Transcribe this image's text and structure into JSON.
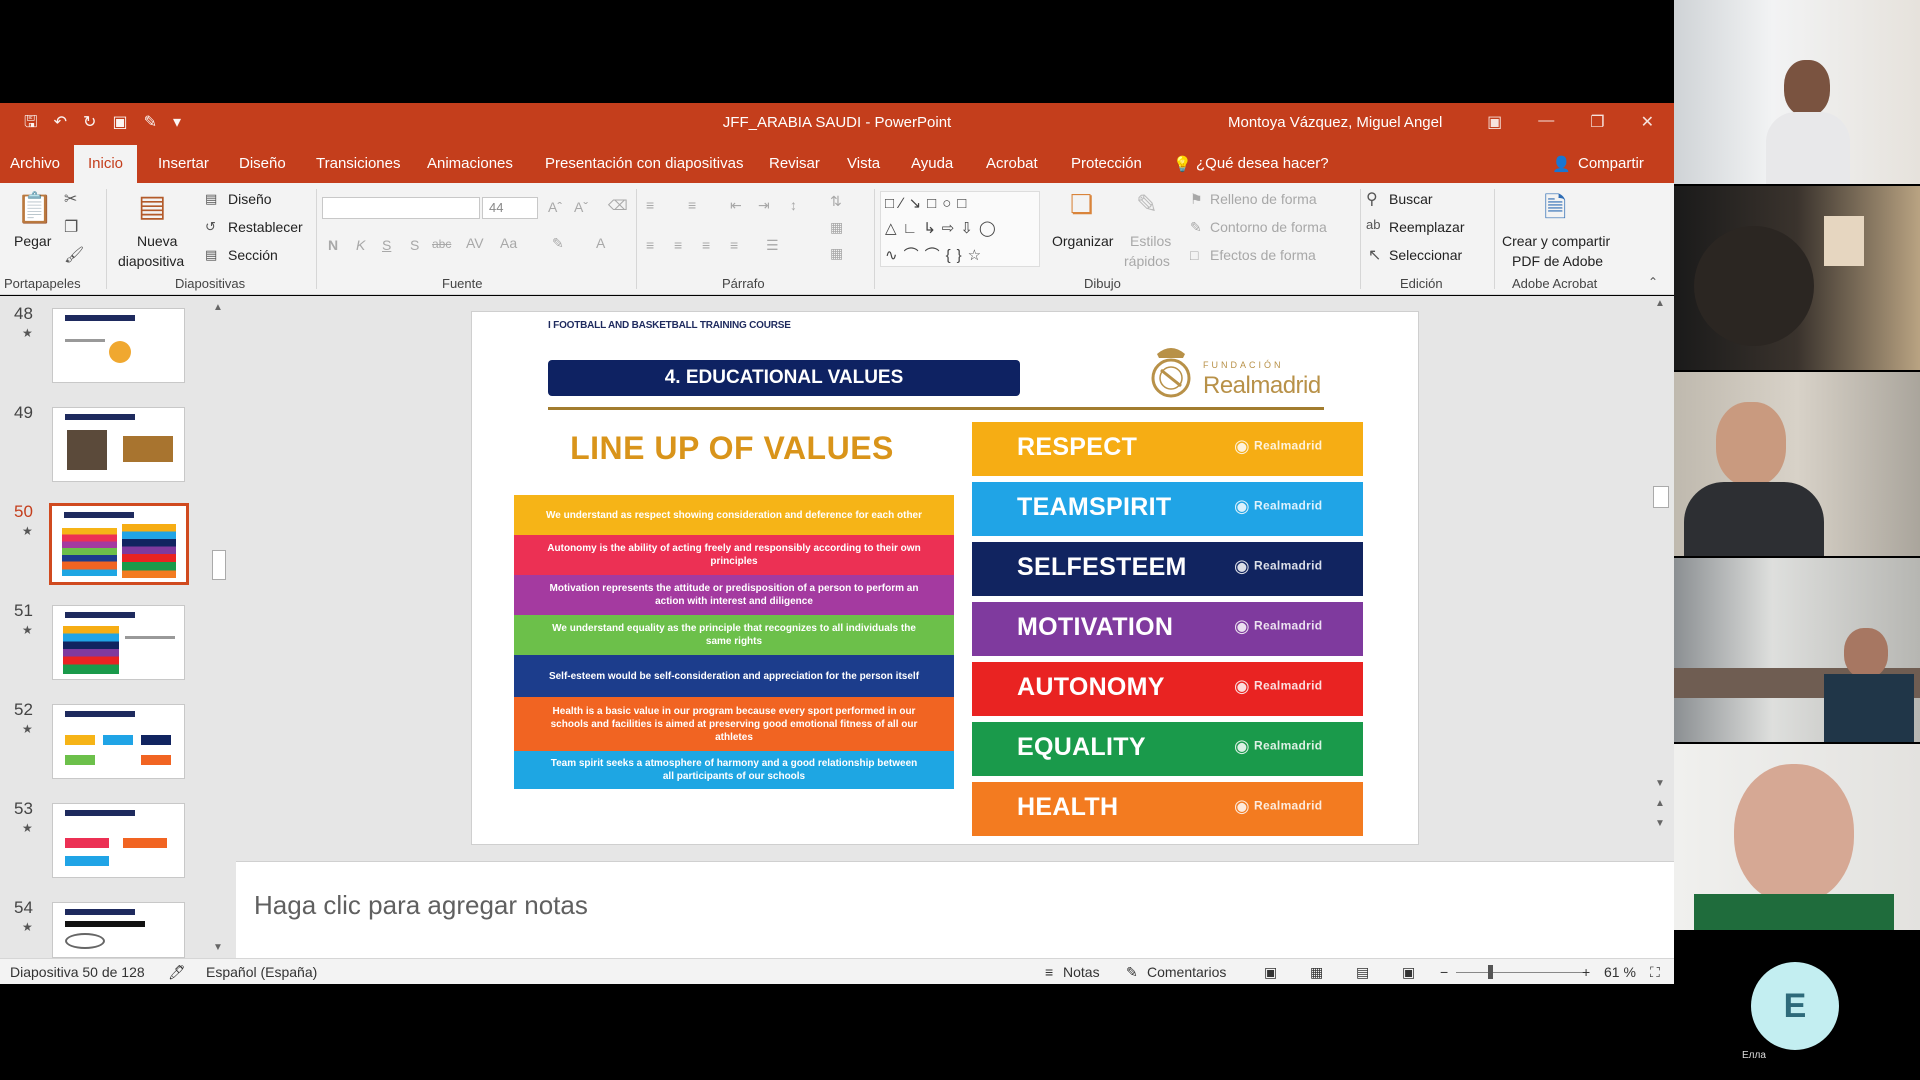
{
  "window": {
    "title": "JFF_ARABIA SAUDI  -  PowerPoint",
    "user": "Montoya Vázquez, Miguel Angel"
  },
  "tabs": [
    "Archivo",
    "Inicio",
    "Insertar",
    "Diseño",
    "Transiciones",
    "Animaciones",
    "Presentación con diapositivas",
    "Revisar",
    "Vista",
    "Ayuda",
    "Acrobat",
    "Protección"
  ],
  "tell_me": "¿Qué desea hacer?",
  "share": "Compartir",
  "ribbon": {
    "portapapeles": {
      "paste": "Pegar",
      "label": "Portapapeles"
    },
    "diapositivas": {
      "new_slide_1": "Nueva",
      "new_slide_2": "diapositiva",
      "design": "Diseño",
      "reset": "Restablecer",
      "section": "Sección",
      "label": "Diapositivas"
    },
    "fuente": {
      "size": "44",
      "bold": "N",
      "italic": "K",
      "underline": "S",
      "shadow": "S",
      "strike": "abc",
      "label": "Fuente"
    },
    "parrafo": {
      "label": "Párrafo"
    },
    "dibujo": {
      "arrange": "Organizar",
      "styles_1": "Estilos",
      "styles_2": "rápidos",
      "fill": "Relleno de forma",
      "outline": "Contorno de forma",
      "effects": "Efectos de forma",
      "label": "Dibujo"
    },
    "edicion": {
      "find": "Buscar",
      "replace": "Reemplazar",
      "select": "Seleccionar",
      "label": "Edición"
    },
    "acrobat": {
      "create_1": "Crear y compartir",
      "create_2": "PDF de Adobe",
      "label": "Adobe Acrobat"
    }
  },
  "thumbnails": [
    {
      "num": "48"
    },
    {
      "num": "49"
    },
    {
      "num": "50",
      "active": true
    },
    {
      "num": "51"
    },
    {
      "num": "52"
    },
    {
      "num": "53"
    },
    {
      "num": "54"
    }
  ],
  "slide": {
    "course": "I FOOTBALL AND BASKETBALL TRAINING COURSE",
    "header": "4. EDUCATIONAL VALUES",
    "logo_fundacion": "FUNDACIÓN",
    "logo_name": "Realmadrid",
    "lineup_title": "LINE UP OF VALUES",
    "definitions": [
      {
        "text": "We understand as respect showing consideration and deference for each other",
        "color": "#f6b417"
      },
      {
        "text": "Autonomy is the ability of acting freely and responsibly according to their own principles",
        "color": "#ec3054"
      },
      {
        "text": "Motivation represents the attitude or predisposition of a person to perform an action with interest and diligence",
        "color": "#a43aa0"
      },
      {
        "text": "We understand equality as the principle that recognizes to all individuals the same rights",
        "color": "#6cc04a"
      },
      {
        "text": "Self-esteem would be self-consideration and appreciation for the person itself",
        "color": "#1c3d8c"
      },
      {
        "text": "Health is a basic value in our program because every sport performed in our schools and facilities is aimed at preserving good emotional fitness of all our athletes",
        "color": "#f16422"
      },
      {
        "text": "Team spirit seeks a atmosphere of harmony and a good relationship between all participants of our schools",
        "color": "#1ea6e3"
      }
    ],
    "values": [
      {
        "label": "RESPECT",
        "color": "#f6ad14"
      },
      {
        "label": "TEAMSPIRIT",
        "color": "#20a4e6"
      },
      {
        "label": "SELFESTEEM",
        "color": "#112460"
      },
      {
        "label": "MOTIVATION",
        "color": "#7f3a9e"
      },
      {
        "label": "AUTONOMY",
        "color": "#e92322"
      },
      {
        "label": "EQUALITY",
        "color": "#1a9a4b"
      },
      {
        "label": "HEALTH",
        "color": "#f37b20"
      }
    ],
    "value_logo": "Realmadrid"
  },
  "notes_placeholder": "Haga clic para agregar notas",
  "status": {
    "slide": "Diapositiva 50 de 128",
    "language": "Español (España)",
    "notes": "Notas",
    "comments": "Comentarios",
    "zoom": "61 %"
  },
  "participants": {
    "avatar_letter": "E",
    "avatar_name": "Елла"
  }
}
